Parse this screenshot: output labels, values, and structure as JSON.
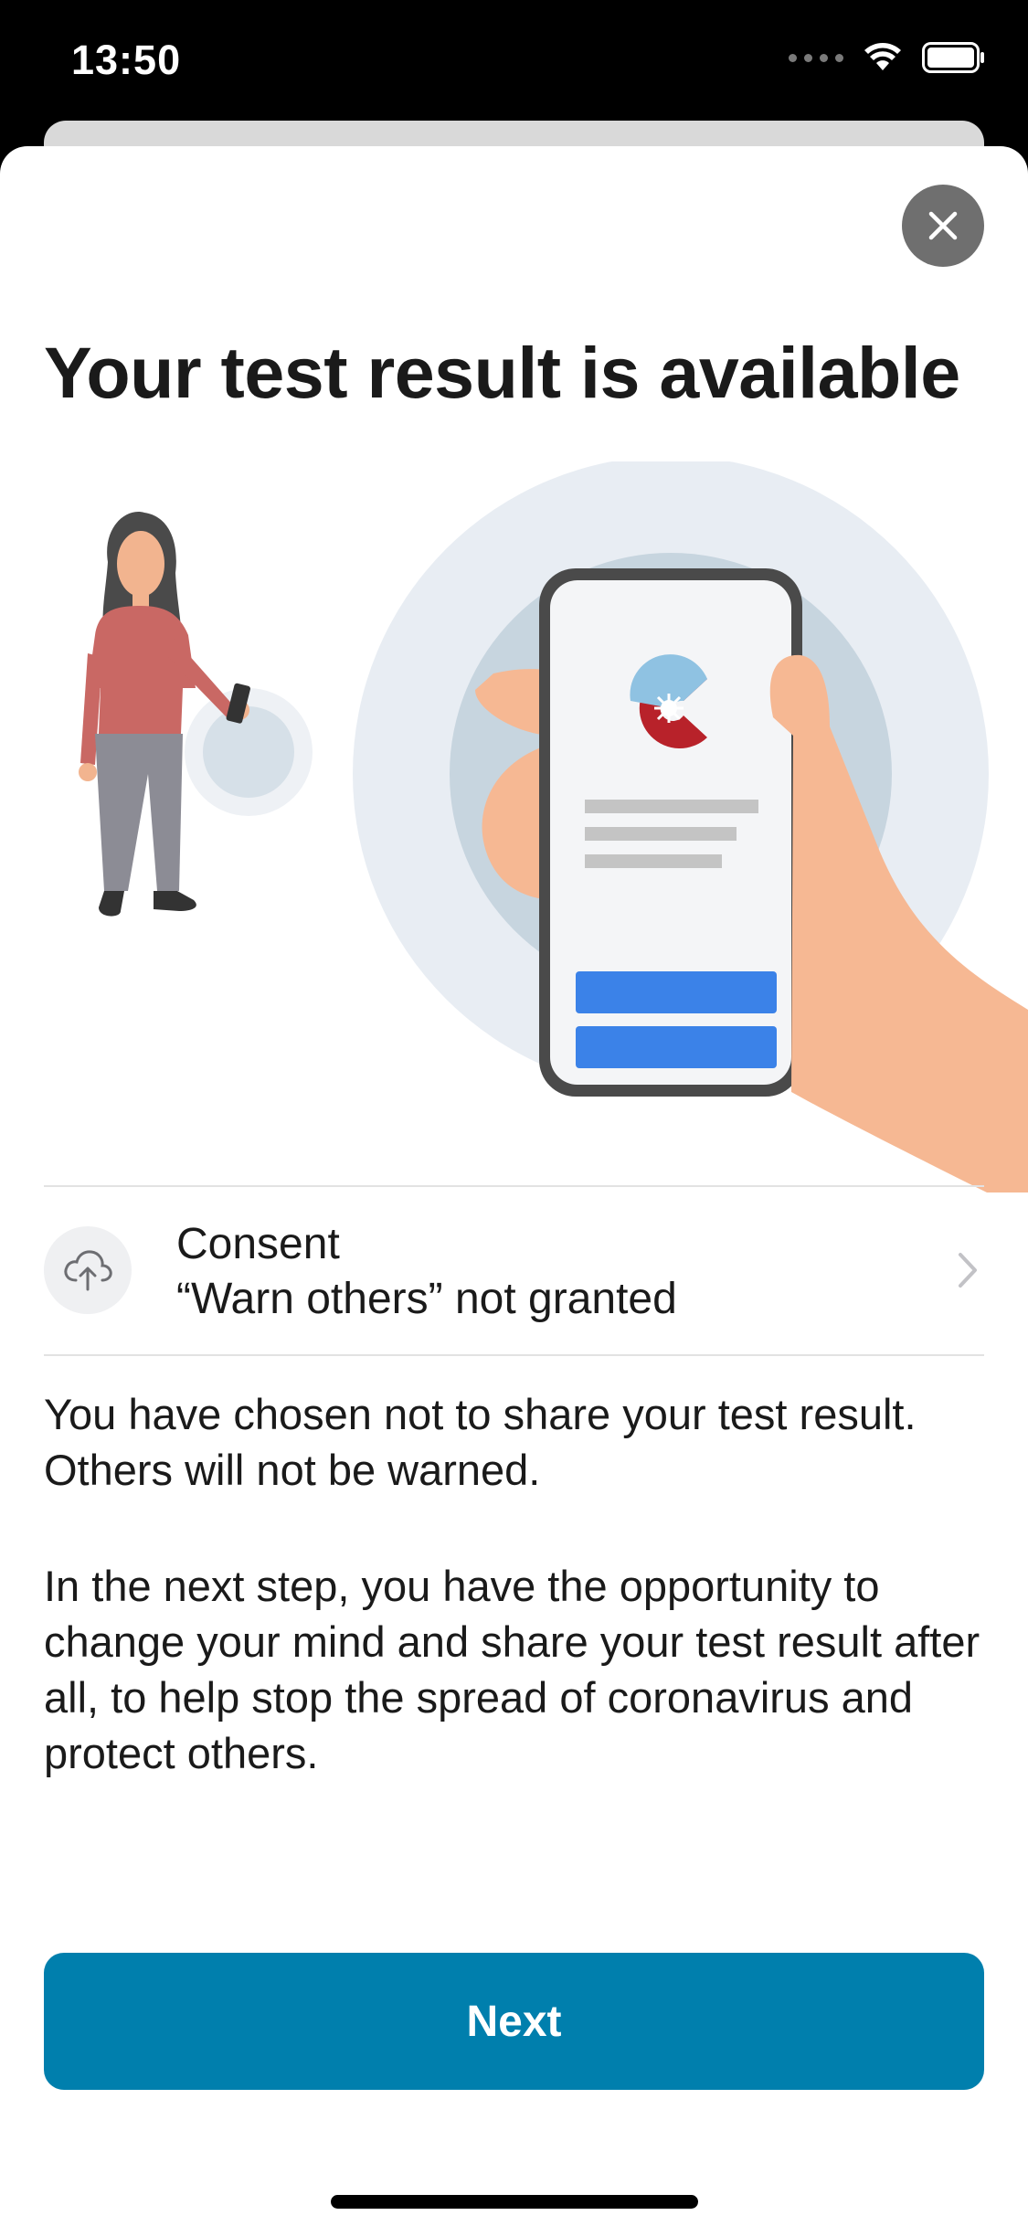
{
  "status_bar": {
    "time": "13:50"
  },
  "sheet": {
    "title": "Your test result is available"
  },
  "consent": {
    "title": "Consent",
    "status": "“Warn others” not granted",
    "icon": "cloud-upload-icon"
  },
  "body": {
    "paragraph1": "You have chosen not to share your test result. Others will not be warned.",
    "paragraph2": "In the next step, you have the opportunity to change your mind and share your test result after all, to help stop the spread of coronavirus and protect others."
  },
  "next_button": {
    "label": "Next"
  },
  "colors": {
    "accent": "#007fad",
    "phone_button": "#3b82e8",
    "close_bg": "#6f6f6f"
  }
}
